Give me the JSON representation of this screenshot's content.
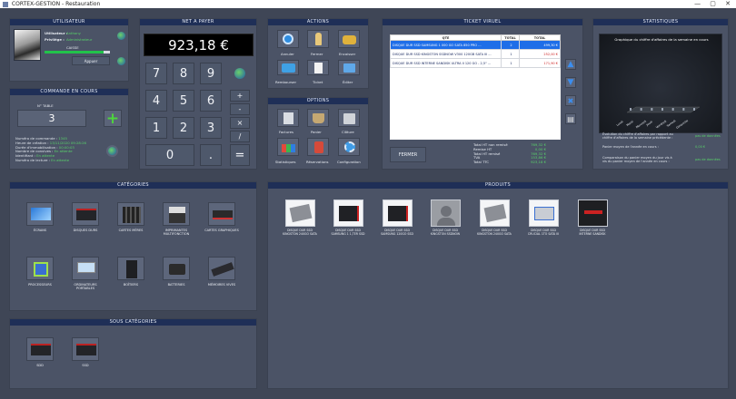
{
  "window": {
    "title": "CORTEX-GESTION - Restauration",
    "controls": "— ▢ ✕"
  },
  "utilisateur": {
    "title": "UTILISATEUR",
    "user_label": "Utilisateur :",
    "user_value": "Anthony",
    "priv_label": "Privilège :",
    "priv_value": "Administrateur",
    "caisse_label": "CAISSE",
    "button_label": "Appuer"
  },
  "net": {
    "title": "NET A PAYER",
    "amount": "923,18 €"
  },
  "keypad": {
    "digits": [
      "7",
      "8",
      "9",
      "4",
      "5",
      "6",
      "1",
      "2",
      "3",
      "0",
      "."
    ],
    "ops": [
      "+",
      "-",
      "×",
      "/"
    ],
    "equals": "="
  },
  "commande": {
    "title": "COMMANDE EN COURS",
    "table_label": "N° TABLE",
    "table_value": "3",
    "rows": [
      {
        "label": "Numéro de commande :",
        "value": "1345"
      },
      {
        "label": "Heure de création :",
        "value": "13/11/2020 09:28:26"
      },
      {
        "label": "Durée d'immobilisation :",
        "value": "00:00:03"
      },
      {
        "label": "Nombre de convives :",
        "value": "En attente"
      },
      {
        "label": "Identifiant :",
        "value": "En attente"
      },
      {
        "label": "Numéro de lecture :",
        "value": "En attente"
      }
    ]
  },
  "actions": {
    "title": "ACTIONS",
    "items": [
      "Annuler",
      "Fermer",
      "Encaisser",
      "Rembourser",
      "Ticket",
      "Éditer"
    ]
  },
  "options": {
    "title": "OPTIONS",
    "items": [
      "Factures",
      "Panier",
      "Clôture",
      "Statistiques",
      "Réservations",
      "Configuration"
    ]
  },
  "ticket": {
    "title": "TICKET VIRUEL",
    "headers": [
      "QTE",
      "TOTAL",
      "TOTAL"
    ],
    "lines": [
      {
        "desc": "DISQUE DUR SSD SAMSUNG 1 000 GO SATA 850 PRO ...",
        "qty": "2",
        "total": "499,30 €",
        "selected": true
      },
      {
        "desc": "DISQUE DUR SSD KINGSTON SSDNOW V300 120GB SATA III ...",
        "qty": "1",
        "total": "252,00 €",
        "selected": false
      },
      {
        "desc": "DISQUE DUR SSD INTERNE SANDISK ULTRA II 120 GO - 2,5\" ...",
        "qty": "1",
        "total": "171,90 €",
        "selected": false
      }
    ],
    "fermer_label": "FERMER",
    "totals": [
      {
        "label": "Total HT non remisé",
        "value": "769,32 €"
      },
      {
        "label": "Remise HT",
        "value": "0,00 €"
      },
      {
        "label": "Total HT remisé",
        "value": "769,32 €"
      },
      {
        "label": "TVA",
        "value": "153,86 €"
      },
      {
        "label": "Total TTC",
        "value": "923,18 €"
      }
    ]
  },
  "stats": {
    "title": "STATISTIQUES",
    "chart_title": "Graphique du chiffre d'affaires de la semaine en cours",
    "days": [
      "Lundi",
      "Mardi",
      "Mercredi",
      "Jeudi",
      "Vendredi",
      "Samedi",
      "Dimanche"
    ],
    "rows": [
      {
        "label": "Évolution du chiffre d'affaires par rapport au chiffre d'affaires de la semaine précédente :",
        "value": "pas de données"
      },
      {
        "label": "Panier moyen de l'année en cours :",
        "value": "0,00 €"
      },
      {
        "label": "Comparaison du panier moyen du jour vis à vis du panier moyen de l'année en cours :",
        "value": "pas de données"
      }
    ]
  },
  "categories": {
    "title": "CATÉGORIES",
    "items": [
      [
        "ÉCRANS"
      ],
      [
        "DISQUES DURS"
      ],
      [
        "CARTES MÈRES"
      ],
      [
        "IMPRIMANTES",
        "MULTIFONCTION"
      ],
      [
        "CARTES GRAPHIQUES"
      ],
      [
        "PROCESSEURS"
      ],
      [
        "ORDINATEURS",
        "PORTABLES"
      ],
      [
        "BOÎTIERS"
      ],
      [
        "BATTERIES"
      ],
      [
        "MÉMOIRES VIVES"
      ]
    ]
  },
  "sous_categories": {
    "title": "SOUS CATÉGORIES",
    "items": [
      "SDD",
      "SSD"
    ]
  },
  "produits": {
    "title": "PRODUITS",
    "items": [
      [
        "DISQUE DUR SSD",
        "KINGSTON 240GO SATA"
      ],
      [
        "DISQUE DUR SSD",
        "SAMSUNG 1 1,TER SSD"
      ],
      [
        "DISQUE DUR SSD",
        "SAMSUNG 120GO SSD"
      ],
      [
        "DISQUE DUR SSD",
        "KINGSTON SSDNOW"
      ],
      [
        "DISQUE DUR SSD",
        "KINGSTON 240GO SATA"
      ],
      [
        "DISQUE DUR SSD",
        "CRUCIAL 1TO SATA III"
      ],
      [
        "DISQUE DUR SSD",
        "INTERNE SANDISK"
      ]
    ]
  }
}
